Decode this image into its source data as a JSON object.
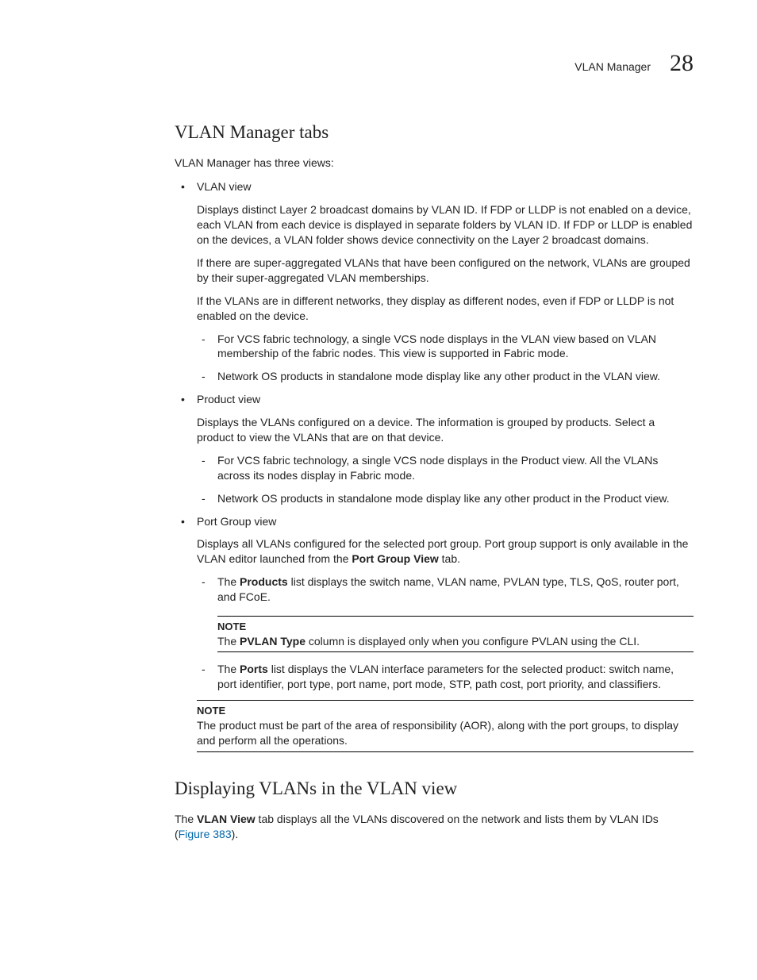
{
  "header": {
    "label": "VLAN Manager",
    "number": "28"
  },
  "section1": {
    "title": "VLAN Manager tabs",
    "intro": "VLAN Manager has three views:",
    "vlan_view": {
      "label": "VLAN view",
      "p1": "Displays distinct Layer 2 broadcast domains by VLAN ID. If FDP or LLDP is not enabled on a device, each VLAN from each device is displayed in separate folders by VLAN ID. If FDP or LLDP is enabled on the devices, a VLAN folder shows device connectivity on the Layer 2 broadcast domains.",
      "p2": "If there are super-aggregated VLANs that have been configured on the network, VLANs are grouped by their super-aggregated VLAN memberships.",
      "p3": "If the VLANs are in different networks, they display as different nodes, even if FDP or LLDP is not enabled on the device.",
      "d1": "For VCS fabric technology, a single VCS node displays in the VLAN view based on VLAN membership of the fabric nodes. This view is supported in Fabric mode.",
      "d2": "Network OS products in standalone mode display like any other product in the VLAN view."
    },
    "product_view": {
      "label": "Product view",
      "p1": "Displays the VLANs configured on a device. The information is grouped by products. Select a product to view the VLANs that are on that device.",
      "d1": "For VCS fabric technology, a single VCS node displays in the Product view. All the VLANs across its nodes display in Fabric mode.",
      "d2": "Network OS products in standalone mode display like any other product in the Product view."
    },
    "port_group_view": {
      "label": "Port Group view",
      "p1_a": "Displays all VLANs configured for the selected port group. Port group support is only available in the VLAN editor launched from the ",
      "p1_b": "Port Group View",
      "p1_c": " tab.",
      "d1_a": "The ",
      "d1_b": "Products",
      "d1_c": " list displays the switch name, VLAN name, PVLAN type, TLS, QoS, router port, and FCoE.",
      "note1_label": "NOTE",
      "note1_a": "The ",
      "note1_b": "PVLAN Type",
      "note1_c": " column is displayed only when you configure PVLAN using the CLI.",
      "d2_a": "The ",
      "d2_b": "Ports",
      "d2_c": " list displays the VLAN interface parameters for the selected product: switch name, port identifier, port type, port name, port mode, STP, path cost, port priority, and classifiers.",
      "note2_label": "NOTE",
      "note2_text": "The product must be part of the area of responsibility (AOR), along with the port groups, to display and perform all the operations."
    }
  },
  "section2": {
    "title": "Displaying VLANs in the VLAN view",
    "p1_a": "The ",
    "p1_b": "VLAN View",
    "p1_c": " tab displays all the VLANs discovered on the network and lists them by VLAN IDs (",
    "p1_link": "Figure 383",
    "p1_d": ")."
  }
}
